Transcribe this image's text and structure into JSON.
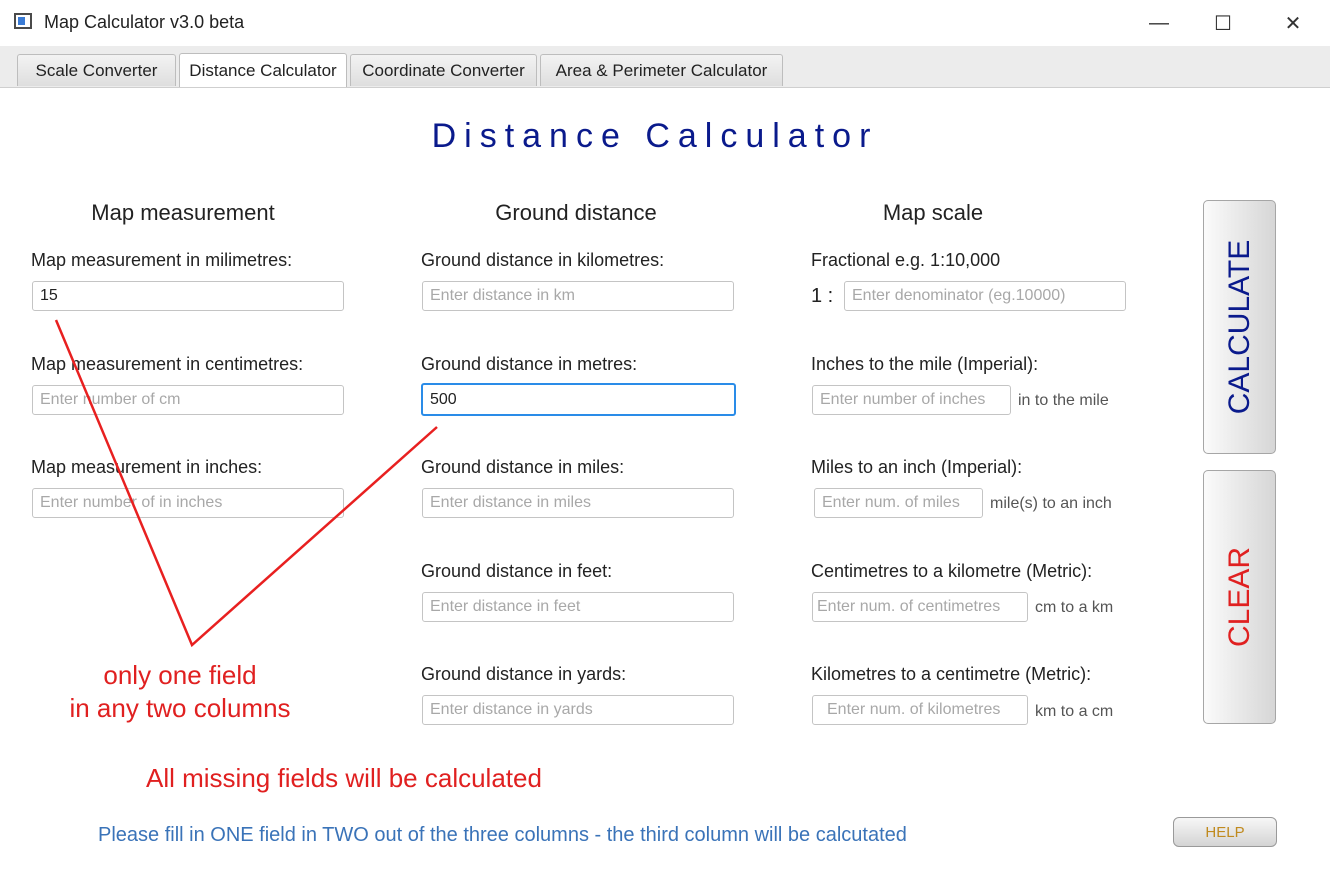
{
  "window": {
    "title": "Map Calculator v3.0 beta",
    "minimize": "—",
    "maximize": "☐",
    "close": "✕"
  },
  "tabs": [
    {
      "label": "Scale Converter"
    },
    {
      "label": "Distance Calculator"
    },
    {
      "label": "Coordinate Converter"
    },
    {
      "label": "Area & Perimeter  Calculator"
    }
  ],
  "active_tab": "Distance Calculator",
  "main": {
    "heading": "Distance Calculator",
    "columns": {
      "map": {
        "title": "Map measurement",
        "fields": [
          {
            "label": "Map measurement in milimetres:",
            "value": "15",
            "placeholder": ""
          },
          {
            "label": "Map measurement in centimetres:",
            "value": "",
            "placeholder": "Enter number of cm"
          },
          {
            "label": "Map measurement in inches:",
            "value": "",
            "placeholder": "Enter number of in inches"
          }
        ]
      },
      "ground": {
        "title": "Ground distance",
        "fields": [
          {
            "label": "Ground distance in kilometres:",
            "value": "",
            "placeholder": "Enter distance in km"
          },
          {
            "label": "Ground distance in metres:",
            "value": "500",
            "placeholder": ""
          },
          {
            "label": "Ground distance in miles:",
            "value": "",
            "placeholder": "Enter distance in miles"
          },
          {
            "label": "Ground distance in feet:",
            "value": "",
            "placeholder": "Enter distance in feet"
          },
          {
            "label": "Ground distance in yards:",
            "value": "",
            "placeholder": "Enter distance in yards"
          }
        ]
      },
      "scale": {
        "title": "Map scale",
        "fields": [
          {
            "label": "Fractional e.g. 1:10,000",
            "prefix": "1 :",
            "value": "",
            "placeholder": "Enter denominator (eg.10000)",
            "suffix": ""
          },
          {
            "label": "Inches to the mile (Imperial):",
            "value": "",
            "placeholder": "Enter number of inches",
            "suffix": "in to the mile"
          },
          {
            "label": "Miles to an inch (Imperial):",
            "value": "",
            "placeholder": "Enter num. of miles",
            "suffix": "mile(s) to an inch"
          },
          {
            "label": "Centimetres to a kilometre (Metric):",
            "value": "",
            "placeholder": "Enter num. of centimetres",
            "suffix": "cm to a km"
          },
          {
            "label": "Kilometres to a centimetre (Metric):",
            "value": "",
            "placeholder": "Enter num. of kilometres",
            "suffix": "km to a cm"
          }
        ]
      }
    },
    "buttons": {
      "calculate": "CALCULATE",
      "clear": "CLEAR",
      "help": "HELP"
    },
    "annotations": {
      "line1": "only one field",
      "line2": "in any two columns",
      "line3": "All missing fields will be calculated"
    },
    "footer_note": "Please fill in ONE field in TWO out of the three columns - the third column will be calcutated"
  },
  "colors": {
    "heading": "#0a1a8c",
    "calculate": "#0a1a8c",
    "clear": "#e02020",
    "annotation": "#e02020",
    "footer_note": "#3a73b8",
    "help": "#c08a1e",
    "focus": "#2a8ce8"
  }
}
